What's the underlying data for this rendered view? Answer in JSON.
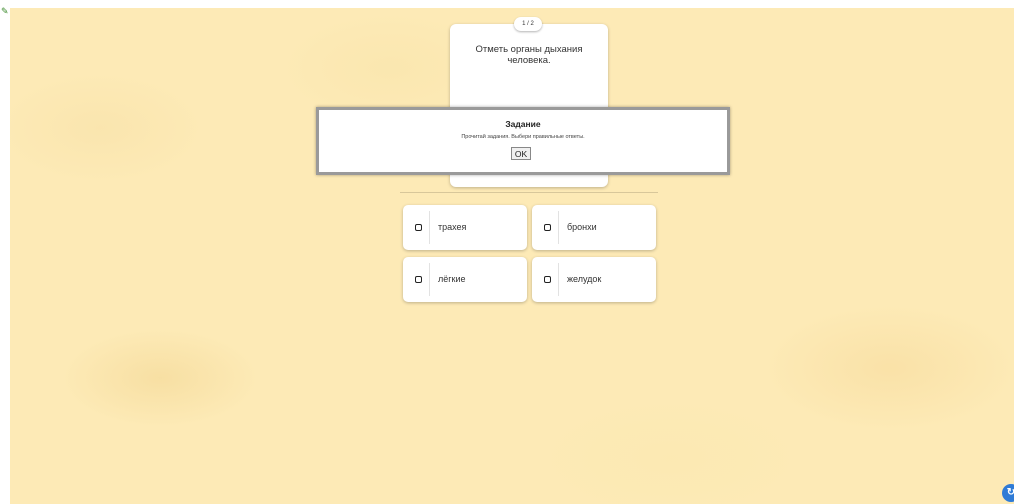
{
  "question": {
    "counter": "1 / 2",
    "text": "Отметь органы дыхания человека."
  },
  "answers": [
    {
      "label": "трахея",
      "checked": false
    },
    {
      "label": "бронхи",
      "checked": false
    },
    {
      "label": "лёгкие",
      "checked": false
    },
    {
      "label": "желудок",
      "checked": false
    }
  ],
  "dialog": {
    "title": "Задание",
    "text": "Прочитай задания. Выбери правильные ответы.",
    "ok_label": "OK"
  },
  "help_button": {
    "icon": "circle-arrow-icon"
  },
  "colors": {
    "background": "#fdeab6",
    "card": "#ffffff",
    "accent": "#2f7bd6"
  }
}
